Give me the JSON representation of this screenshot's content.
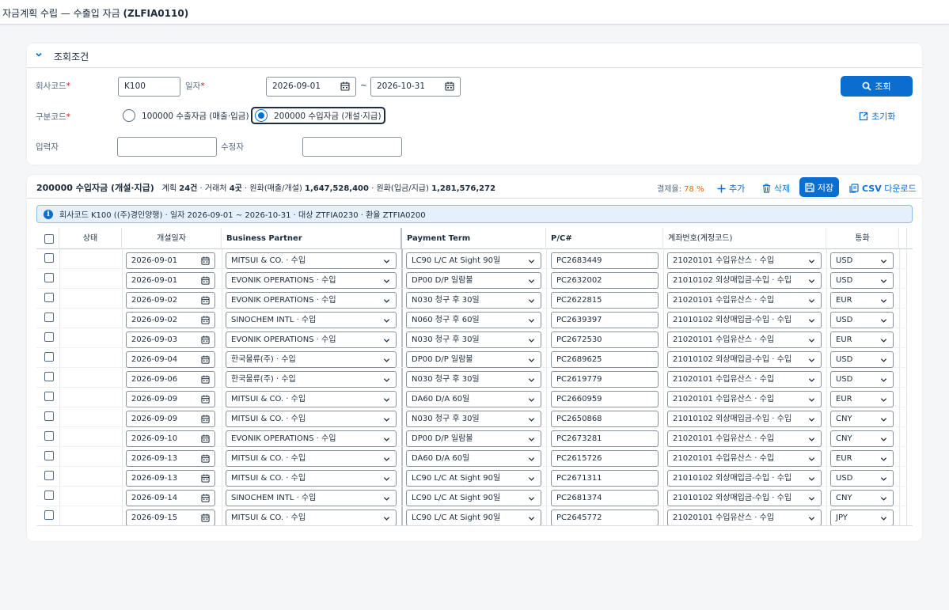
{
  "app": {
    "title_prefix": "자금계획 수립 — 수출입 자금 ",
    "title_code": "(ZLFIA0110)"
  },
  "filter": {
    "section_title": "조회조건",
    "company_label": "회사코드",
    "company_value": "K100",
    "date_label": "일자",
    "date_from": "2026-09-01",
    "date_sep": "~",
    "date_to": "2026-10-31",
    "type_label": "구분코드",
    "type_options": [
      {
        "label": "100000 수출자금 (매출·입금)",
        "selected": false
      },
      {
        "label": "200000 수입자금 (개설·지급)",
        "selected": true
      }
    ],
    "creator_label": "입력자",
    "creator_value": "",
    "modifier_label": "수정자",
    "modifier_value": "",
    "search_button": "조회",
    "reset_button": "초기화",
    "required_mark": "*"
  },
  "result": {
    "title": "200000 수입자금 (개설·지급)",
    "stat_plan_label": "계획",
    "stat_plan_value": "24건",
    "stat_partner_label": "거래처",
    "stat_partner_value": "4곳",
    "stat_orig_label": "원화(매출/개설)",
    "stat_orig_value": "1,647,528,400",
    "stat_paid_label": "원화(입금/지급)",
    "stat_paid_value": "1,281,576,272",
    "rate_label": "결제율:",
    "rate_value": "78 %",
    "add_button": "추가",
    "delete_button": "삭제",
    "save_button": "저장",
    "csv_prefix": "CSV",
    "csv_button": "다운로드",
    "info_text": "회사코드 K100 ((주)경인양행) · 일자 2026-09-01 ~ 2026-10-31 · 대상 ZTFIA0230 · 환율 ZTFIA0200"
  },
  "table": {
    "headers": [
      "상태",
      "개설일자",
      "Business Partner",
      "Payment Term",
      "P/C#",
      "계좌번호(계정코드)",
      "통화"
    ],
    "rows": [
      {
        "status": "",
        "date": "2026-09-01",
        "partner": "MITSUI & CO. · 수입",
        "term": "LC90 L/C At Sight 90일",
        "pc": "PC2683449",
        "account": "21020101 수입유산스 · 수입",
        "currency": "USD"
      },
      {
        "status": "",
        "date": "2026-09-01",
        "partner": "EVONIK OPERATIONS · 수입",
        "term": "DP00 D/P 일람불",
        "pc": "PC2632002",
        "account": "21010102 외상매입금-수입 · 수입",
        "currency": "USD"
      },
      {
        "status": "",
        "date": "2026-09-02",
        "partner": "EVONIK OPERATIONS · 수입",
        "term": "N030 청구 후 30일",
        "pc": "PC2622815",
        "account": "21020101 수입유산스 · 수입",
        "currency": "EUR"
      },
      {
        "status": "",
        "date": "2026-09-02",
        "partner": "SINOCHEM INTL · 수입",
        "term": "N060 청구 후 60일",
        "pc": "PC2639397",
        "account": "21010102 외상매입금-수입 · 수입",
        "currency": "USD"
      },
      {
        "status": "",
        "date": "2026-09-03",
        "partner": "EVONIK OPERATIONS · 수입",
        "term": "N030 청구 후 30일",
        "pc": "PC2672530",
        "account": "21020101 수입유산스 · 수입",
        "currency": "EUR"
      },
      {
        "status": "",
        "date": "2026-09-04",
        "partner": "한국물류(주) · 수입",
        "term": "DP00 D/P 일람불",
        "pc": "PC2689625",
        "account": "21010102 외상매입금-수입 · 수입",
        "currency": "USD"
      },
      {
        "status": "",
        "date": "2026-09-06",
        "partner": "한국물류(주) · 수입",
        "term": "N030 청구 후 30일",
        "pc": "PC2619779",
        "account": "21020101 수입유산스 · 수입",
        "currency": "USD"
      },
      {
        "status": "",
        "date": "2026-09-09",
        "partner": "MITSUI & CO. · 수입",
        "term": "DA60 D/A 60일",
        "pc": "PC2660959",
        "account": "21020101 수입유산스 · 수입",
        "currency": "EUR"
      },
      {
        "status": "",
        "date": "2026-09-09",
        "partner": "MITSUI & CO. · 수입",
        "term": "N030 청구 후 30일",
        "pc": "PC2650868",
        "account": "21010102 외상매입금-수입 · 수입",
        "currency": "CNY"
      },
      {
        "status": "",
        "date": "2026-09-10",
        "partner": "EVONIK OPERATIONS · 수입",
        "term": "DP00 D/P 일람불",
        "pc": "PC2673281",
        "account": "21020101 수입유산스 · 수입",
        "currency": "CNY"
      },
      {
        "status": "",
        "date": "2026-09-13",
        "partner": "MITSUI & CO. · 수입",
        "term": "DA60 D/A 60일",
        "pc": "PC2615726",
        "account": "21020101 수입유산스 · 수입",
        "currency": "EUR"
      },
      {
        "status": "",
        "date": "2026-09-13",
        "partner": "MITSUI & CO. · 수입",
        "term": "LC90 L/C At Sight 90일",
        "pc": "PC2671311",
        "account": "21010102 외상매입금-수입 · 수입",
        "currency": "USD"
      },
      {
        "status": "",
        "date": "2026-09-14",
        "partner": "SINOCHEM INTL · 수입",
        "term": "LC90 L/C At Sight 90일",
        "pc": "PC2681374",
        "account": "21010102 외상매입금-수입 · 수입",
        "currency": "CNY"
      },
      {
        "status": "",
        "date": "2026-09-15",
        "partner": "MITSUI & CO. · 수입",
        "term": "LC90 L/C At Sight 90일",
        "pc": "PC2645772",
        "account": "21020101 수입유산스 · 수입",
        "currency": "JPY"
      }
    ]
  }
}
